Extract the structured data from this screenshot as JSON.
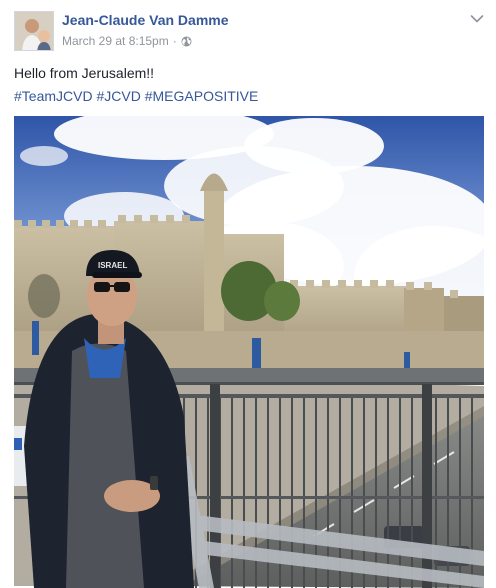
{
  "post": {
    "author": "Jean-Claude Van Damme",
    "timestamp": "March 29 at 8:15pm",
    "separator": "·",
    "privacy_icon": "globe-icon",
    "options_icon": "chevron-down-icon",
    "message": "Hello from Jerusalem!!",
    "hashtags": [
      "#TeamJCVD",
      "#JCVD",
      "#MEGAPOSITIVE"
    ],
    "photo_cap_text": "ISRAEL"
  },
  "colors": {
    "link": "#365899",
    "text": "#1d2129",
    "meta": "#90949c",
    "sky": "#3a5fb0"
  }
}
